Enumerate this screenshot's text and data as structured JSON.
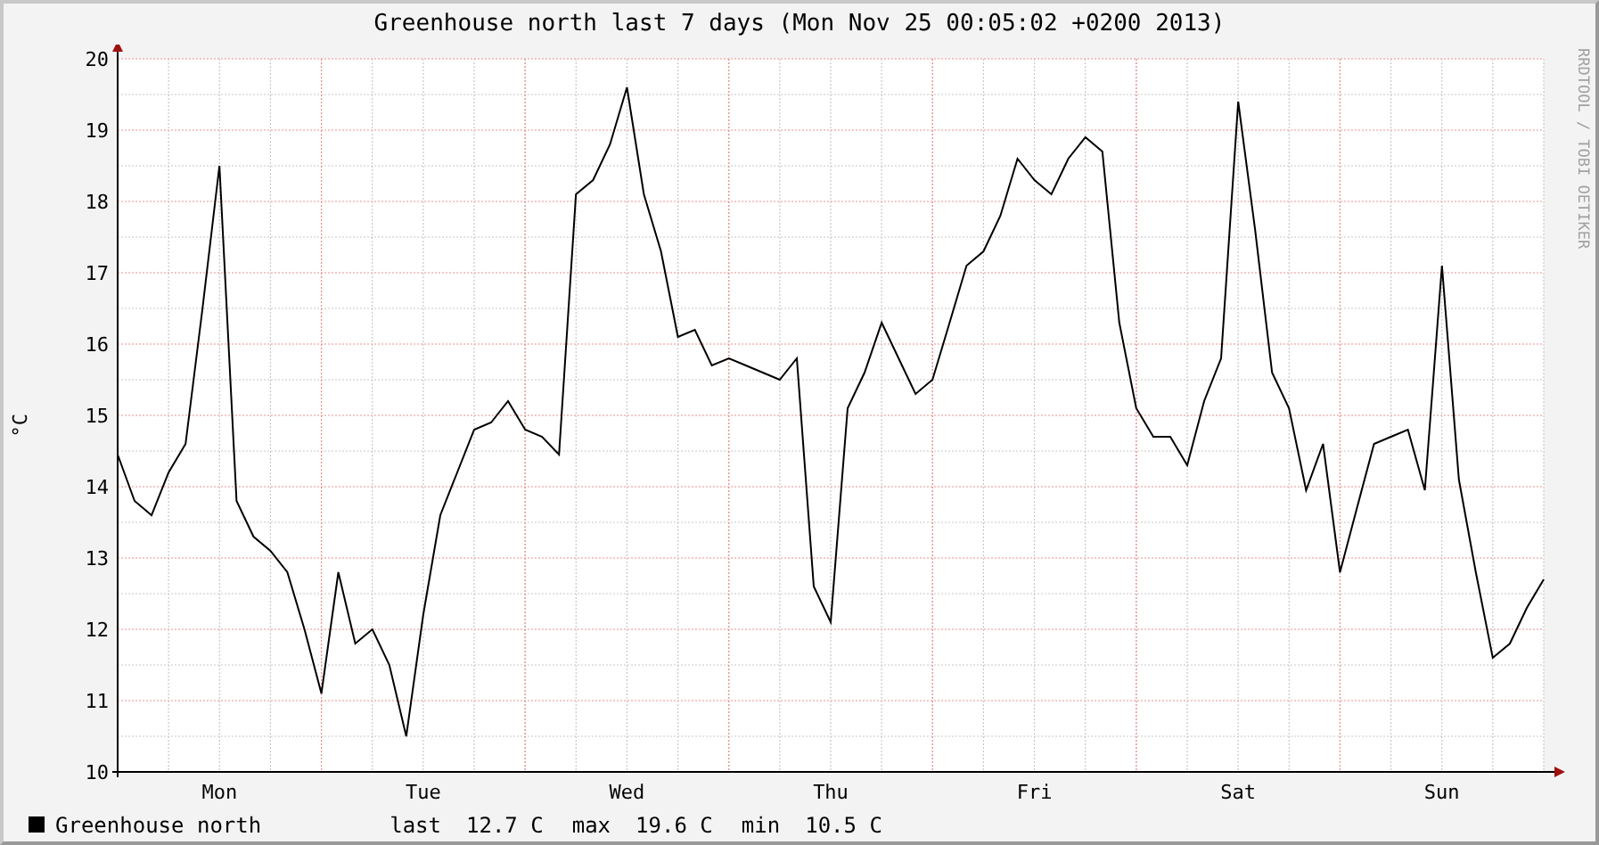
{
  "title": "Greenhouse north last 7 days (Mon Nov 25 00:05:02 +0200 2013)",
  "watermark": "RRDTOOL / TOBI OETIKER",
  "chart": {
    "chart_data": {
      "type": "line",
      "grid": true,
      "ylabel": "°C",
      "ylim": [
        10,
        20
      ],
      "yticks": [
        10,
        11,
        12,
        13,
        14,
        15,
        16,
        17,
        18,
        19,
        20
      ],
      "categories": [
        null,
        null,
        null,
        null,
        null,
        null,
        "Mon",
        null,
        null,
        null,
        null,
        null,
        null,
        null,
        null,
        null,
        null,
        null,
        "Tue",
        null,
        null,
        null,
        null,
        null,
        null,
        null,
        null,
        null,
        null,
        null,
        "Wed",
        null,
        null,
        null,
        null,
        null,
        null,
        null,
        null,
        null,
        null,
        null,
        "Thu",
        null,
        null,
        null,
        null,
        null,
        null,
        null,
        null,
        null,
        null,
        null,
        "Fri",
        null,
        null,
        null,
        null,
        null,
        null,
        null,
        null,
        null,
        null,
        null,
        "Sat",
        null,
        null,
        null,
        null,
        null,
        null,
        null,
        null,
        null,
        null,
        null,
        "Sun",
        null,
        null,
        null,
        null,
        null,
        null
      ],
      "series": [
        {
          "name": "Greenhouse north",
          "color": "#000000",
          "values": [
            14.45,
            13.8,
            13.6,
            14.2,
            14.6,
            16.5,
            18.5,
            13.8,
            13.3,
            13.1,
            12.8,
            12.0,
            11.1,
            12.8,
            11.8,
            12.0,
            11.5,
            10.5,
            12.2,
            13.6,
            14.2,
            14.8,
            14.9,
            15.2,
            14.8,
            14.7,
            14.45,
            18.1,
            18.3,
            18.8,
            19.6,
            18.1,
            17.3,
            16.1,
            16.2,
            15.7,
            15.8,
            15.7,
            15.6,
            15.5,
            15.8,
            12.6,
            12.1,
            15.1,
            15.6,
            16.3,
            15.8,
            15.3,
            15.5,
            16.3,
            17.1,
            17.3,
            17.8,
            18.6,
            18.3,
            18.1,
            18.6,
            18.9,
            18.7,
            16.3,
            15.1,
            14.7,
            14.7,
            14.3,
            15.2,
            15.8,
            19.4,
            17.6,
            15.6,
            15.1,
            13.95,
            14.6,
            12.8,
            13.7,
            14.6,
            14.7,
            14.8,
            13.95,
            17.1,
            14.1,
            12.8,
            11.6,
            11.8,
            12.3,
            12.7
          ]
        }
      ]
    }
  },
  "legend": {
    "stats": [
      {
        "label": "last",
        "value": "12.7 C"
      },
      {
        "label": "max",
        "value": "19.6 C"
      },
      {
        "label": "min",
        "value": "10.5 C"
      }
    ]
  }
}
